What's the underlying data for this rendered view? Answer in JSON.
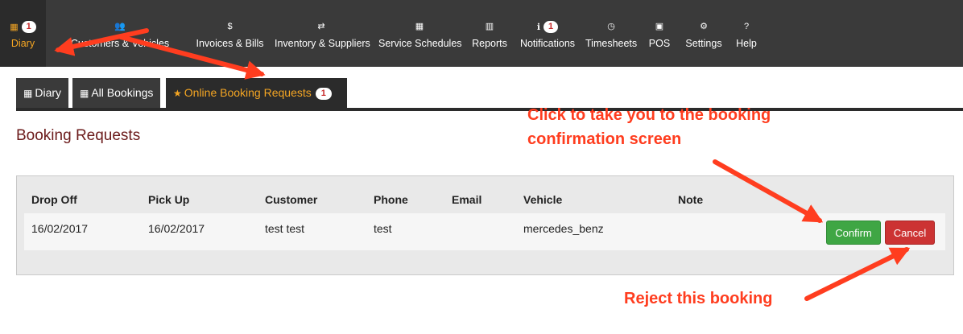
{
  "nav": {
    "diary": {
      "label": "Diary",
      "badge": "1"
    },
    "customers": {
      "label": "Customers & Vehicles"
    },
    "invoices": {
      "label": "Invoices & Bills",
      "icon_glyph": "$"
    },
    "inventory": {
      "label": "Inventory & Suppliers"
    },
    "schedules": {
      "label": "Service Schedules"
    },
    "reports": {
      "label": "Reports"
    },
    "notifications": {
      "label": "Notifications",
      "badge": "1"
    },
    "timesheets": {
      "label": "Timesheets"
    },
    "pos": {
      "label": "POS"
    },
    "settings": {
      "label": "Settings"
    },
    "help": {
      "label": "Help",
      "icon_glyph": "?"
    }
  },
  "tabs": {
    "diary": {
      "label": "Diary"
    },
    "all_bookings": {
      "label": "All Bookings"
    },
    "online": {
      "label": "Online Booking Requests",
      "badge": "1"
    }
  },
  "page_title": "Booking Requests",
  "table": {
    "headers": {
      "drop_off": "Drop Off",
      "pick_up": "Pick Up",
      "customer": "Customer",
      "phone": "Phone",
      "email": "Email",
      "vehicle": "Vehicle",
      "note": "Note"
    },
    "rows": [
      {
        "drop_off": "16/02/2017",
        "pick_up": "16/02/2017",
        "customer": "test test",
        "phone": "test",
        "email": "",
        "vehicle": "mercedes_benz",
        "note": "",
        "confirm_label": "Confirm",
        "cancel_label": "Cancel"
      }
    ]
  },
  "annotations": {
    "confirm_line1": "Click to take you to the booking",
    "confirm_line2": "confirmation screen",
    "reject": "Reject this booking"
  },
  "colors": {
    "nav_bg": "#3a3a3a",
    "active_accent": "#f5a623",
    "title": "#6b1a1a",
    "confirm": "#3fa644",
    "cancel": "#cc3333",
    "annotation": "#ff3d1f"
  }
}
